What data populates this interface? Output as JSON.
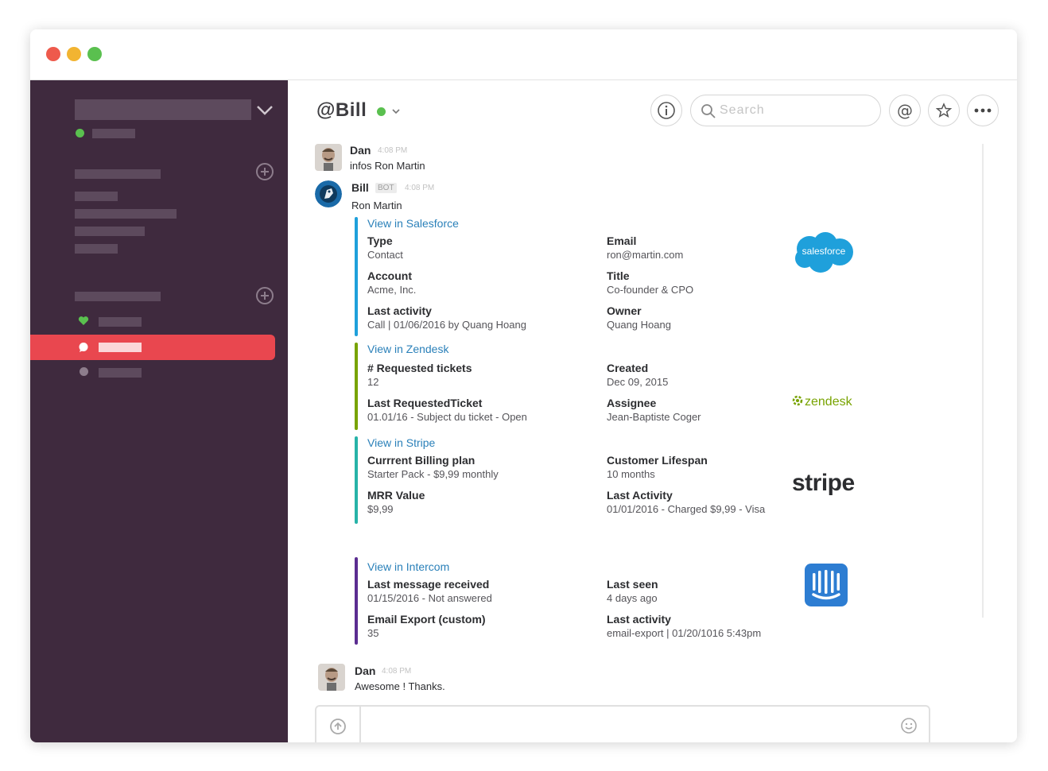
{
  "channel": {
    "title": "@Bill"
  },
  "search": {
    "placeholder": "Search"
  },
  "header_icons": {
    "info": "info-icon",
    "mention": "@",
    "star": "star-icon",
    "more": "more-icon"
  },
  "messages": [
    {
      "name": "Dan",
      "time": "4:08 PM",
      "text": "infos Ron Martin"
    },
    {
      "name": "Bill",
      "badge": "BOT",
      "time": "4:08 PM",
      "text": "Ron Martin"
    },
    {
      "name": "Dan",
      "time": "4:08 PM",
      "text": "Awesome ! Thanks."
    }
  ],
  "attachments": {
    "salesforce": {
      "link": "View in Salesforce",
      "logo_text": "salesforce",
      "color": "#1fa0db",
      "fields": [
        {
          "label": "Type",
          "value": "Contact"
        },
        {
          "label": "Email",
          "value": "ron@martin.com"
        },
        {
          "label": "Account",
          "value": "Acme, Inc."
        },
        {
          "label": "Title",
          "value": "Co-founder & CPO"
        },
        {
          "label": "Last activity",
          "value": "Call | 01/06/2016 by Quang Hoang"
        },
        {
          "label": "Owner",
          "value": "Quang Hoang"
        }
      ]
    },
    "zendesk": {
      "link": "View in Zendesk",
      "logo_text": "zendesk",
      "color": "#78a300",
      "fields": [
        {
          "label": "# Requested tickets",
          "value": "12"
        },
        {
          "label": "Created",
          "value": "Dec 09, 2015"
        },
        {
          "label": "Last RequestedTicket",
          "value": "01.01/16 - Subject du ticket - Open"
        },
        {
          "label": "Assignee",
          "value": "Jean-Baptiste Coger"
        }
      ]
    },
    "stripe": {
      "link": "View in Stripe",
      "logo_text": "stripe",
      "color": "#27b3a8",
      "fields": [
        {
          "label": "Currrent Billing plan",
          "value": "Starter Pack - $9,99 monthly"
        },
        {
          "label": "Customer Lifespan",
          "value": "10 months"
        },
        {
          "label": "MRR Value",
          "value": "$9,99"
        },
        {
          "label": "Last Activity",
          "value": "01/01/2016 - Charged $9,99 - Visa"
        }
      ]
    },
    "intercom": {
      "link": "View in Intercom",
      "color": "#5b2d91",
      "fields": [
        {
          "label": "Last message received",
          "value": "01/15/2016 - Not answered"
        },
        {
          "label": "Last seen",
          "value": "4 days ago"
        },
        {
          "label": "Email Export (custom)",
          "value": "35"
        },
        {
          "label": "Last activity",
          "value": "email-export | 01/20/1016 5:43pm"
        }
      ]
    }
  },
  "colors": {
    "sidebar": "#3f2a3e",
    "active": "#e9474f",
    "online": "#5ac04f",
    "link": "#2a80b9"
  }
}
